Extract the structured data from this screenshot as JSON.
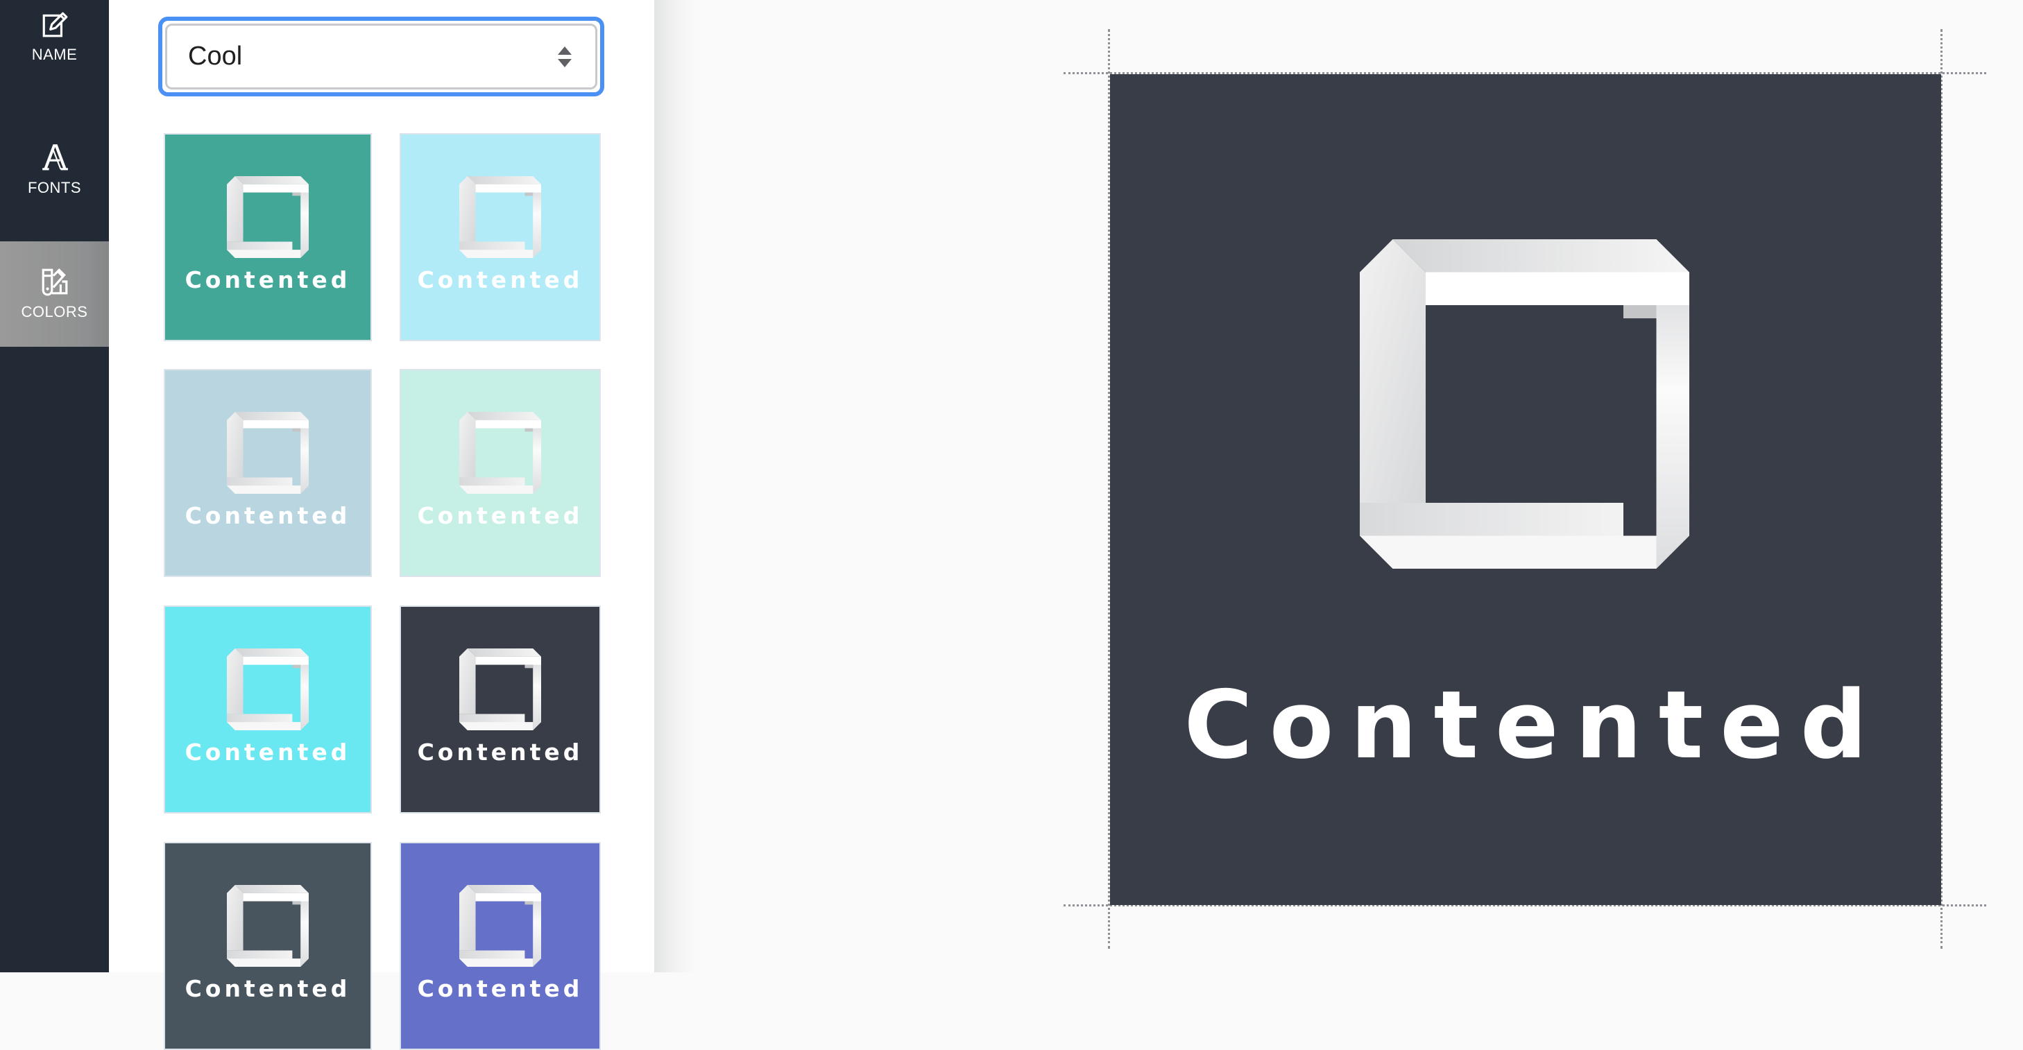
{
  "sidebar": {
    "items": [
      {
        "label": "NAME",
        "icon": "edit-icon",
        "active": false
      },
      {
        "label": "FONTS",
        "icon": "font-icon",
        "active": false
      },
      {
        "label": "COLORS",
        "icon": "color-swatch-icon",
        "active": true
      }
    ]
  },
  "palette_select": {
    "value": "Cool",
    "icon": "select-arrows-icon"
  },
  "thumbnails": [
    {
      "text": "Contented",
      "background": "#43a798"
    },
    {
      "text": "Contented",
      "background": "#b2ebf8"
    },
    {
      "text": "Contented",
      "background": "#b8d5e0"
    },
    {
      "text": "Contented",
      "background": "#c6efe5"
    },
    {
      "text": "Contented",
      "background": "#6ae8f2"
    },
    {
      "text": "Contented",
      "background": "#393d47"
    },
    {
      "text": "Contented",
      "background": "#48555e"
    },
    {
      "text": "Contented",
      "background": "#6570c9"
    }
  ],
  "preview": {
    "text": "Contented",
    "background": "#393d47",
    "icon": "impossible-square-logo-icon"
  }
}
